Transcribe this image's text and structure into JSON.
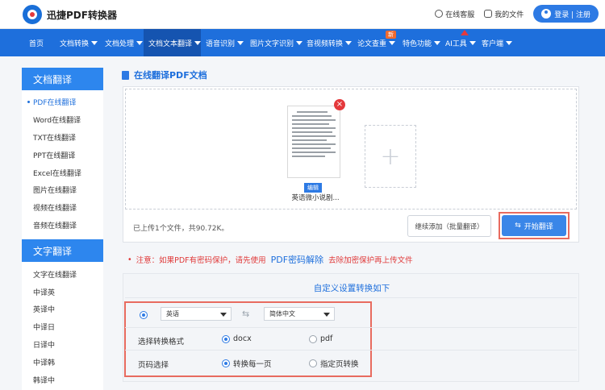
{
  "header": {
    "brand": "迅捷PDF转换器",
    "service": "在线客服",
    "my_files": "我的文件",
    "login": "登录 | 注册"
  },
  "nav": {
    "items": [
      {
        "label": "首页",
        "has_menu": false
      },
      {
        "label": "文档转换",
        "has_menu": true
      },
      {
        "label": "文档处理",
        "has_menu": true
      },
      {
        "label": "文档文本翻译",
        "has_menu": true,
        "active": true
      },
      {
        "label": "语音识别",
        "has_menu": true
      },
      {
        "label": "图片文字识别",
        "has_menu": true
      },
      {
        "label": "音视频转换",
        "has_menu": true
      },
      {
        "label": "论文查重",
        "has_menu": true,
        "badge": "新"
      },
      {
        "label": "特色功能",
        "has_menu": true
      },
      {
        "label": "AI工具",
        "has_menu": true
      },
      {
        "label": "客户端",
        "has_menu": true
      }
    ]
  },
  "sidebar": {
    "section1_title": "文档翻译",
    "section1_items": [
      "PDF在线翻译",
      "Word在线翻译",
      "TXT在线翻译",
      "PPT在线翻译",
      "Excel在线翻译",
      "图片在线翻译",
      "视频在线翻译",
      "音频在线翻译"
    ],
    "section2_title": "文字翻译",
    "section2_items": [
      "文字在线翻译",
      "中译英",
      "英译中",
      "中译日",
      "日译中",
      "中译韩",
      "韩译中"
    ]
  },
  "main": {
    "title": "在线翻译PDF文档",
    "file": {
      "name": "英语微小说剧...",
      "edit_label": "编辑"
    },
    "upload_status": "已上传1个文件，共90.72K。",
    "continue_button": "继续添加（批量翻译）",
    "start_button": "开始翻译"
  },
  "notice": {
    "prefix": "注意：如果PDF有密码保护，请先使用",
    "link": "PDF密码解除",
    "suffix": "去除加密保护再上传文件"
  },
  "settings": {
    "title": "自定义设置转换如下",
    "source_lang": "英语",
    "target_lang": "简体中文",
    "format_label": "选择转换格式",
    "format_options": [
      "docx",
      "pdf"
    ],
    "format_selected": "docx",
    "page_label": "页码选择",
    "page_options": [
      "转换每一页",
      "指定页转换"
    ],
    "page_selected": "转换每一页"
  }
}
